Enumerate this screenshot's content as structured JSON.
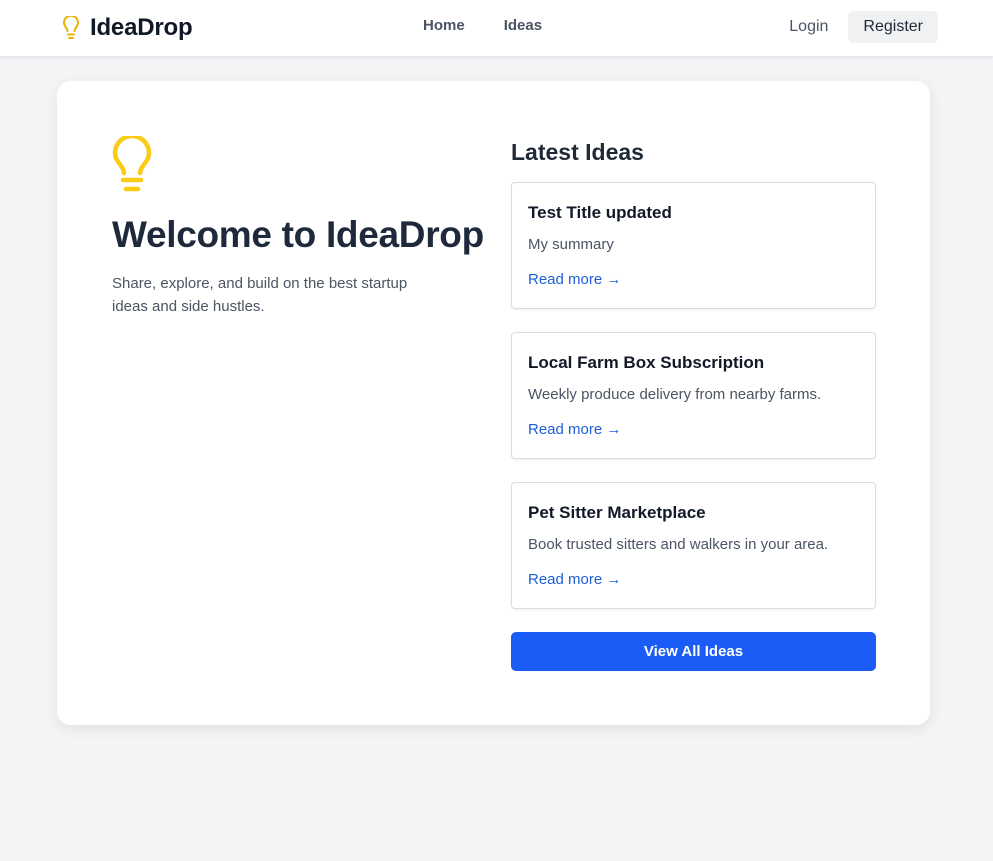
{
  "brand": {
    "name": "IdeaDrop",
    "icon": "lightbulb-icon",
    "icon_color": "#eab308"
  },
  "nav": {
    "links": [
      {
        "label": "Home"
      },
      {
        "label": "Ideas"
      }
    ],
    "login_label": "Login",
    "register_label": "Register"
  },
  "hero": {
    "icon": "lightbulb-icon",
    "icon_color": "#facc15",
    "title": "Welcome to IdeaDrop",
    "subtitle": "Share, explore, and build on the best startup ideas and side hustles."
  },
  "latest": {
    "heading": "Latest Ideas",
    "ideas": [
      {
        "title": "Test Title updated",
        "summary": "My summary",
        "link_label": "Read more →"
      },
      {
        "title": "Local Farm Box Subscription",
        "summary": "Weekly produce delivery from nearby farms.",
        "link_label": "Read more →"
      },
      {
        "title": "Pet Sitter Marketplace",
        "summary": "Book trusted sitters and walkers in your area.",
        "link_label": "Read more →"
      }
    ],
    "view_all_label": "View All Ideas"
  },
  "colors": {
    "accent": "#1a5cf5",
    "link": "#1d5fd6",
    "page_bg": "#f3f4f6"
  }
}
